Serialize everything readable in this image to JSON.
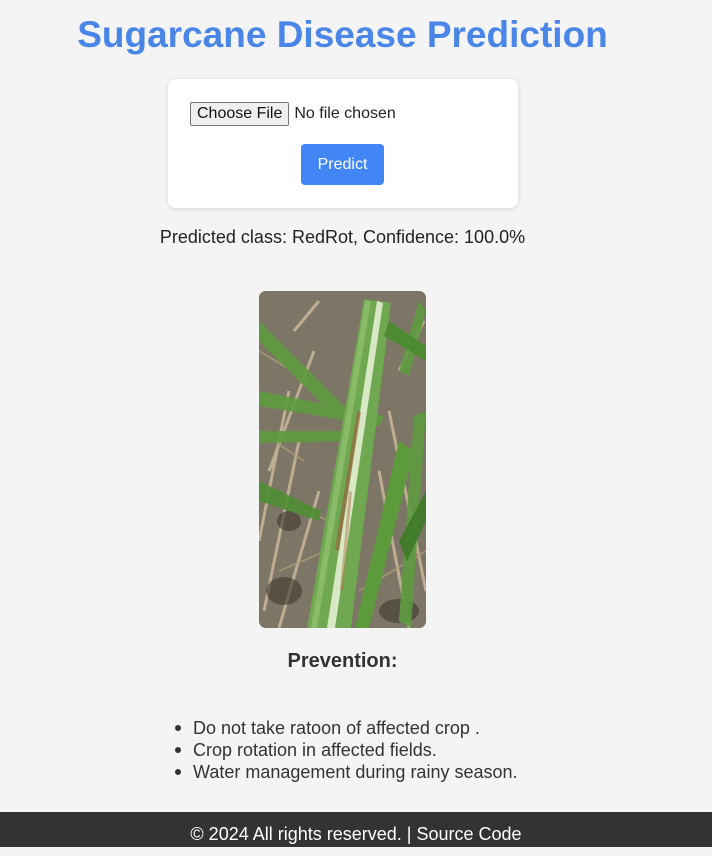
{
  "page": {
    "title": "Sugarcane Disease Prediction"
  },
  "upload": {
    "choose_file_label": "Choose File",
    "file_status": "No file chosen",
    "predict_label": "Predict"
  },
  "result": {
    "text": "Predicted class: RedRot, Confidence: 100.0%"
  },
  "prevention": {
    "title": "Prevention:",
    "tips": [
      "Do not take ratoon of affected crop .",
      "Crop rotation in affected fields.",
      "Water management during rainy season."
    ]
  },
  "footer": {
    "copyright": "© 2024 All rights reserved. |",
    "source_link": "Source Code"
  },
  "colors": {
    "title": "#4a86e8",
    "button": "#4285f4",
    "footer_bg": "#333333",
    "page_bg": "#f4f4f4"
  }
}
